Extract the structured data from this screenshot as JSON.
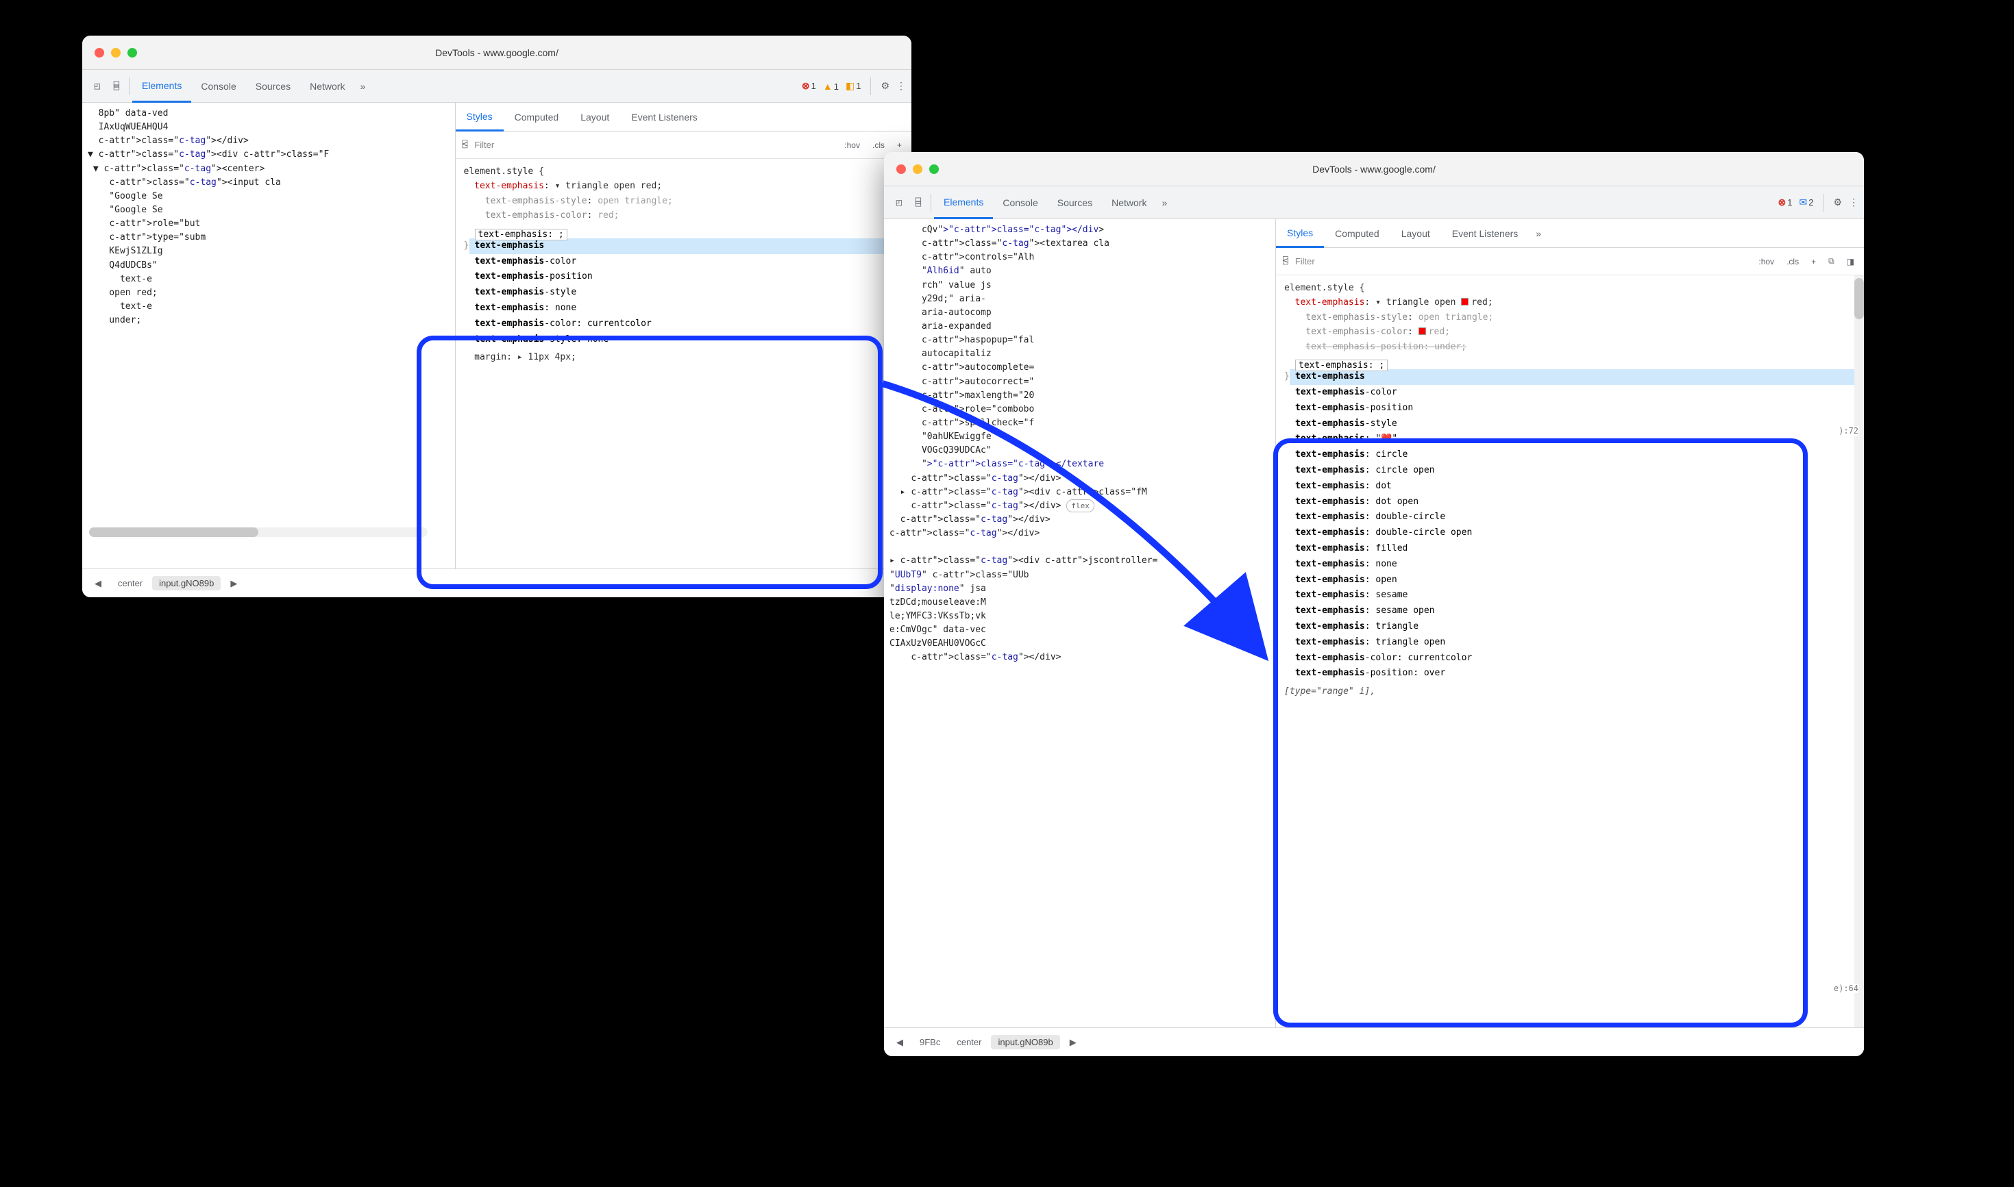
{
  "windowA": {
    "title": "DevTools - www.google.com/",
    "toolbarTabs": {
      "elements": "Elements",
      "console": "Console",
      "sources": "Sources",
      "network": "Network"
    },
    "errors": "1",
    "warnings": "1",
    "issues": "1",
    "sidePanelTabs": {
      "styles": "Styles",
      "computed": "Computed",
      "layout": "Layout",
      "eventListeners": "Event Listeners"
    },
    "filterPlaceholder": "Filter",
    "filterButtons": {
      "hov": ":hov",
      "cls": ".cls",
      "plus": "+"
    },
    "elementsHtml": [
      "  8pb\" data-ved",
      "  IAxUqWUEAHQU4",
      "  </div>",
      "▼ <div class=\"F",
      " ▼ <center>",
      "    <input cla",
      "    \"Google Se",
      "    \"Google Se",
      "    role=\"but",
      "    type=\"subm",
      "    KEwjS1ZLIg",
      "    Q4dUDCBs\"",
      "      text-e",
      "    open red;",
      "      text-e",
      "    under;"
    ],
    "stylesPre": {
      "selector": "element.style {",
      "mainProp": "text-emphasis",
      "mainVal": "▾ triangle open red;",
      "sub1Prop": "text-emphasis-style",
      "sub1Val": "open triangle;",
      "sub2Prop": "text-emphasis-color",
      "sub2Val": "red;"
    },
    "editValue": "text-emphasis: ;",
    "autocomplete": [
      "text-emphasis",
      "text-emphasis-color",
      "text-emphasis-position",
      "text-emphasis-style",
      "text-emphasis: none",
      "text-emphasis-color: currentcolor",
      "text-emphasis-style: none"
    ],
    "postLine": "  margin: ▸ 11px 4px;",
    "matchBold": "text-emphasis",
    "breadcrumbs": {
      "arrow": "◀",
      "b1": "center",
      "b2": "input.gNO89b",
      "arrowR": "▶"
    }
  },
  "windowB": {
    "title": "DevTools - www.google.com/",
    "toolbarTabs": {
      "elements": "Elements",
      "console": "Console",
      "sources": "Sources",
      "network": "Network"
    },
    "errors": "1",
    "messages": "2",
    "sidePanelTabs": {
      "styles": "Styles",
      "computed": "Computed",
      "layout": "Layout",
      "eventListeners": "Event Listeners"
    },
    "filterPlaceholder": "Filter",
    "filterButtons": {
      "hov": ":hov",
      "cls": ".cls",
      "plus": "+"
    },
    "elementsHtml": [
      "      cQv\"></div>",
      "      <textarea cla",
      "      controls=\"Alh",
      "      \"Alh6id\" auto",
      "      rch\" value js",
      "      y29d;\" aria-",
      "      aria-autocomp",
      "      aria-expanded",
      "      haspopup=\"fal",
      "      autocapitaliz",
      "      autocomplete=",
      "      autocorrect=\"",
      "      maxlength=\"20",
      "      role=\"combobo",
      "      spellcheck=\"f",
      "      \"0ahUKEwiggfe",
      "      VOGcQ39UDCAc\"",
      "      \"></textare",
      "    </div>",
      "  ▸ <div class=\"fM",
      "    </div> (flex)",
      "  </div>",
      "</div>",
      "",
      "▸ <div jscontroller=",
      "\"UUbT9\" class=\"UUb",
      "\"display:none\" jsa",
      "tzDCd;mouseleave:M",
      "le;YMFC3:VKssTb;vk",
      "e:CmVOgc\" data-vec",
      "CIAxUzV0EAHU0VOGcC",
      "    </div>"
    ],
    "stylesPre": {
      "selector": "element.style {",
      "mainProp": "text-emphasis",
      "mainVal": "▾ triangle open",
      "mainValRed": "red;",
      "sub1Prop": "text-emphasis-style",
      "sub1Val": "open triangle;",
      "sub2Prop": "text-emphasis-color",
      "sub2Val": "red;",
      "struck": "text-emphasis-position: under;"
    },
    "editValue": "text-emphasis: ;",
    "autocomplete": [
      "text-emphasis",
      "text-emphasis-color",
      "text-emphasis-position",
      "text-emphasis-style",
      "text-emphasis: \"❤️\"",
      "text-emphasis: circle",
      "text-emphasis: circle open",
      "text-emphasis: dot",
      "text-emphasis: dot open",
      "text-emphasis: double-circle",
      "text-emphasis: double-circle open",
      "text-emphasis: filled",
      "text-emphasis: none",
      "text-emphasis: open",
      "text-emphasis: sesame",
      "text-emphasis: sesame open",
      "text-emphasis: triangle",
      "text-emphasis: triangle open",
      "text-emphasis-color: currentcolor",
      "text-emphasis-position: over"
    ],
    "matchBold": "text-emphasis",
    "ghost1": "):72",
    "ghost2": "e):64",
    "postLine": "[type=\"range\" i],",
    "breadcrumbs": {
      "arrow": "◀",
      "b0": "9FBc",
      "b1": "center",
      "b2": "input.gNO89b",
      "arrowR": "▶"
    }
  }
}
